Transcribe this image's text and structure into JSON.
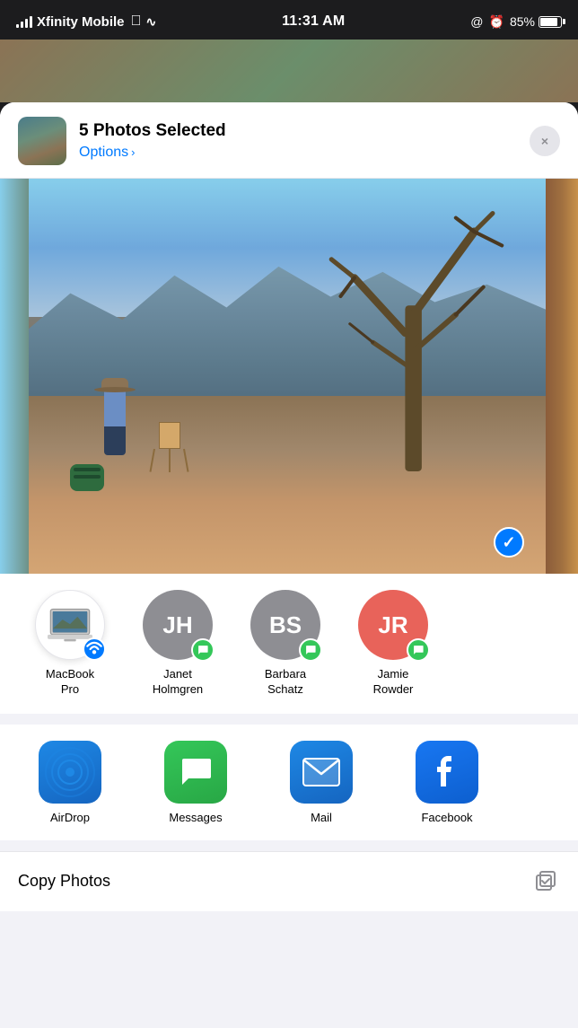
{
  "status_bar": {
    "carrier": "Xfinity Mobile",
    "time": "11:31 AM",
    "battery_percent": "85%"
  },
  "share_sheet": {
    "header": {
      "title": "5 Photos Selected",
      "options_label": "Options",
      "chevron": "›",
      "close_label": "×"
    },
    "people": [
      {
        "id": "macbook",
        "initials": "",
        "name_line1": "MacBook",
        "name_line2": "Pro",
        "avatar_type": "macbook",
        "badge_type": "airdrop"
      },
      {
        "id": "janet",
        "initials": "JH",
        "name_line1": "Janet",
        "name_line2": "Holmgren",
        "avatar_type": "gray",
        "badge_type": "messages"
      },
      {
        "id": "barbara",
        "initials": "BS",
        "name_line1": "Barbara",
        "name_line2": "Schatz",
        "avatar_type": "gray",
        "badge_type": "messages"
      },
      {
        "id": "jamie",
        "initials": "JR",
        "name_line1": "Jamie",
        "name_line2": "Rowder",
        "avatar_type": "red",
        "badge_type": "messages"
      }
    ],
    "apps": [
      {
        "id": "airdrop",
        "name": "AirDrop",
        "icon_type": "airdrop"
      },
      {
        "id": "messages",
        "name": "Messages",
        "icon_type": "messages"
      },
      {
        "id": "mail",
        "name": "Mail",
        "icon_type": "mail"
      },
      {
        "id": "facebook",
        "name": "Facebook",
        "icon_type": "facebook"
      }
    ],
    "bottom_action": {
      "label": "Copy Photos"
    }
  }
}
